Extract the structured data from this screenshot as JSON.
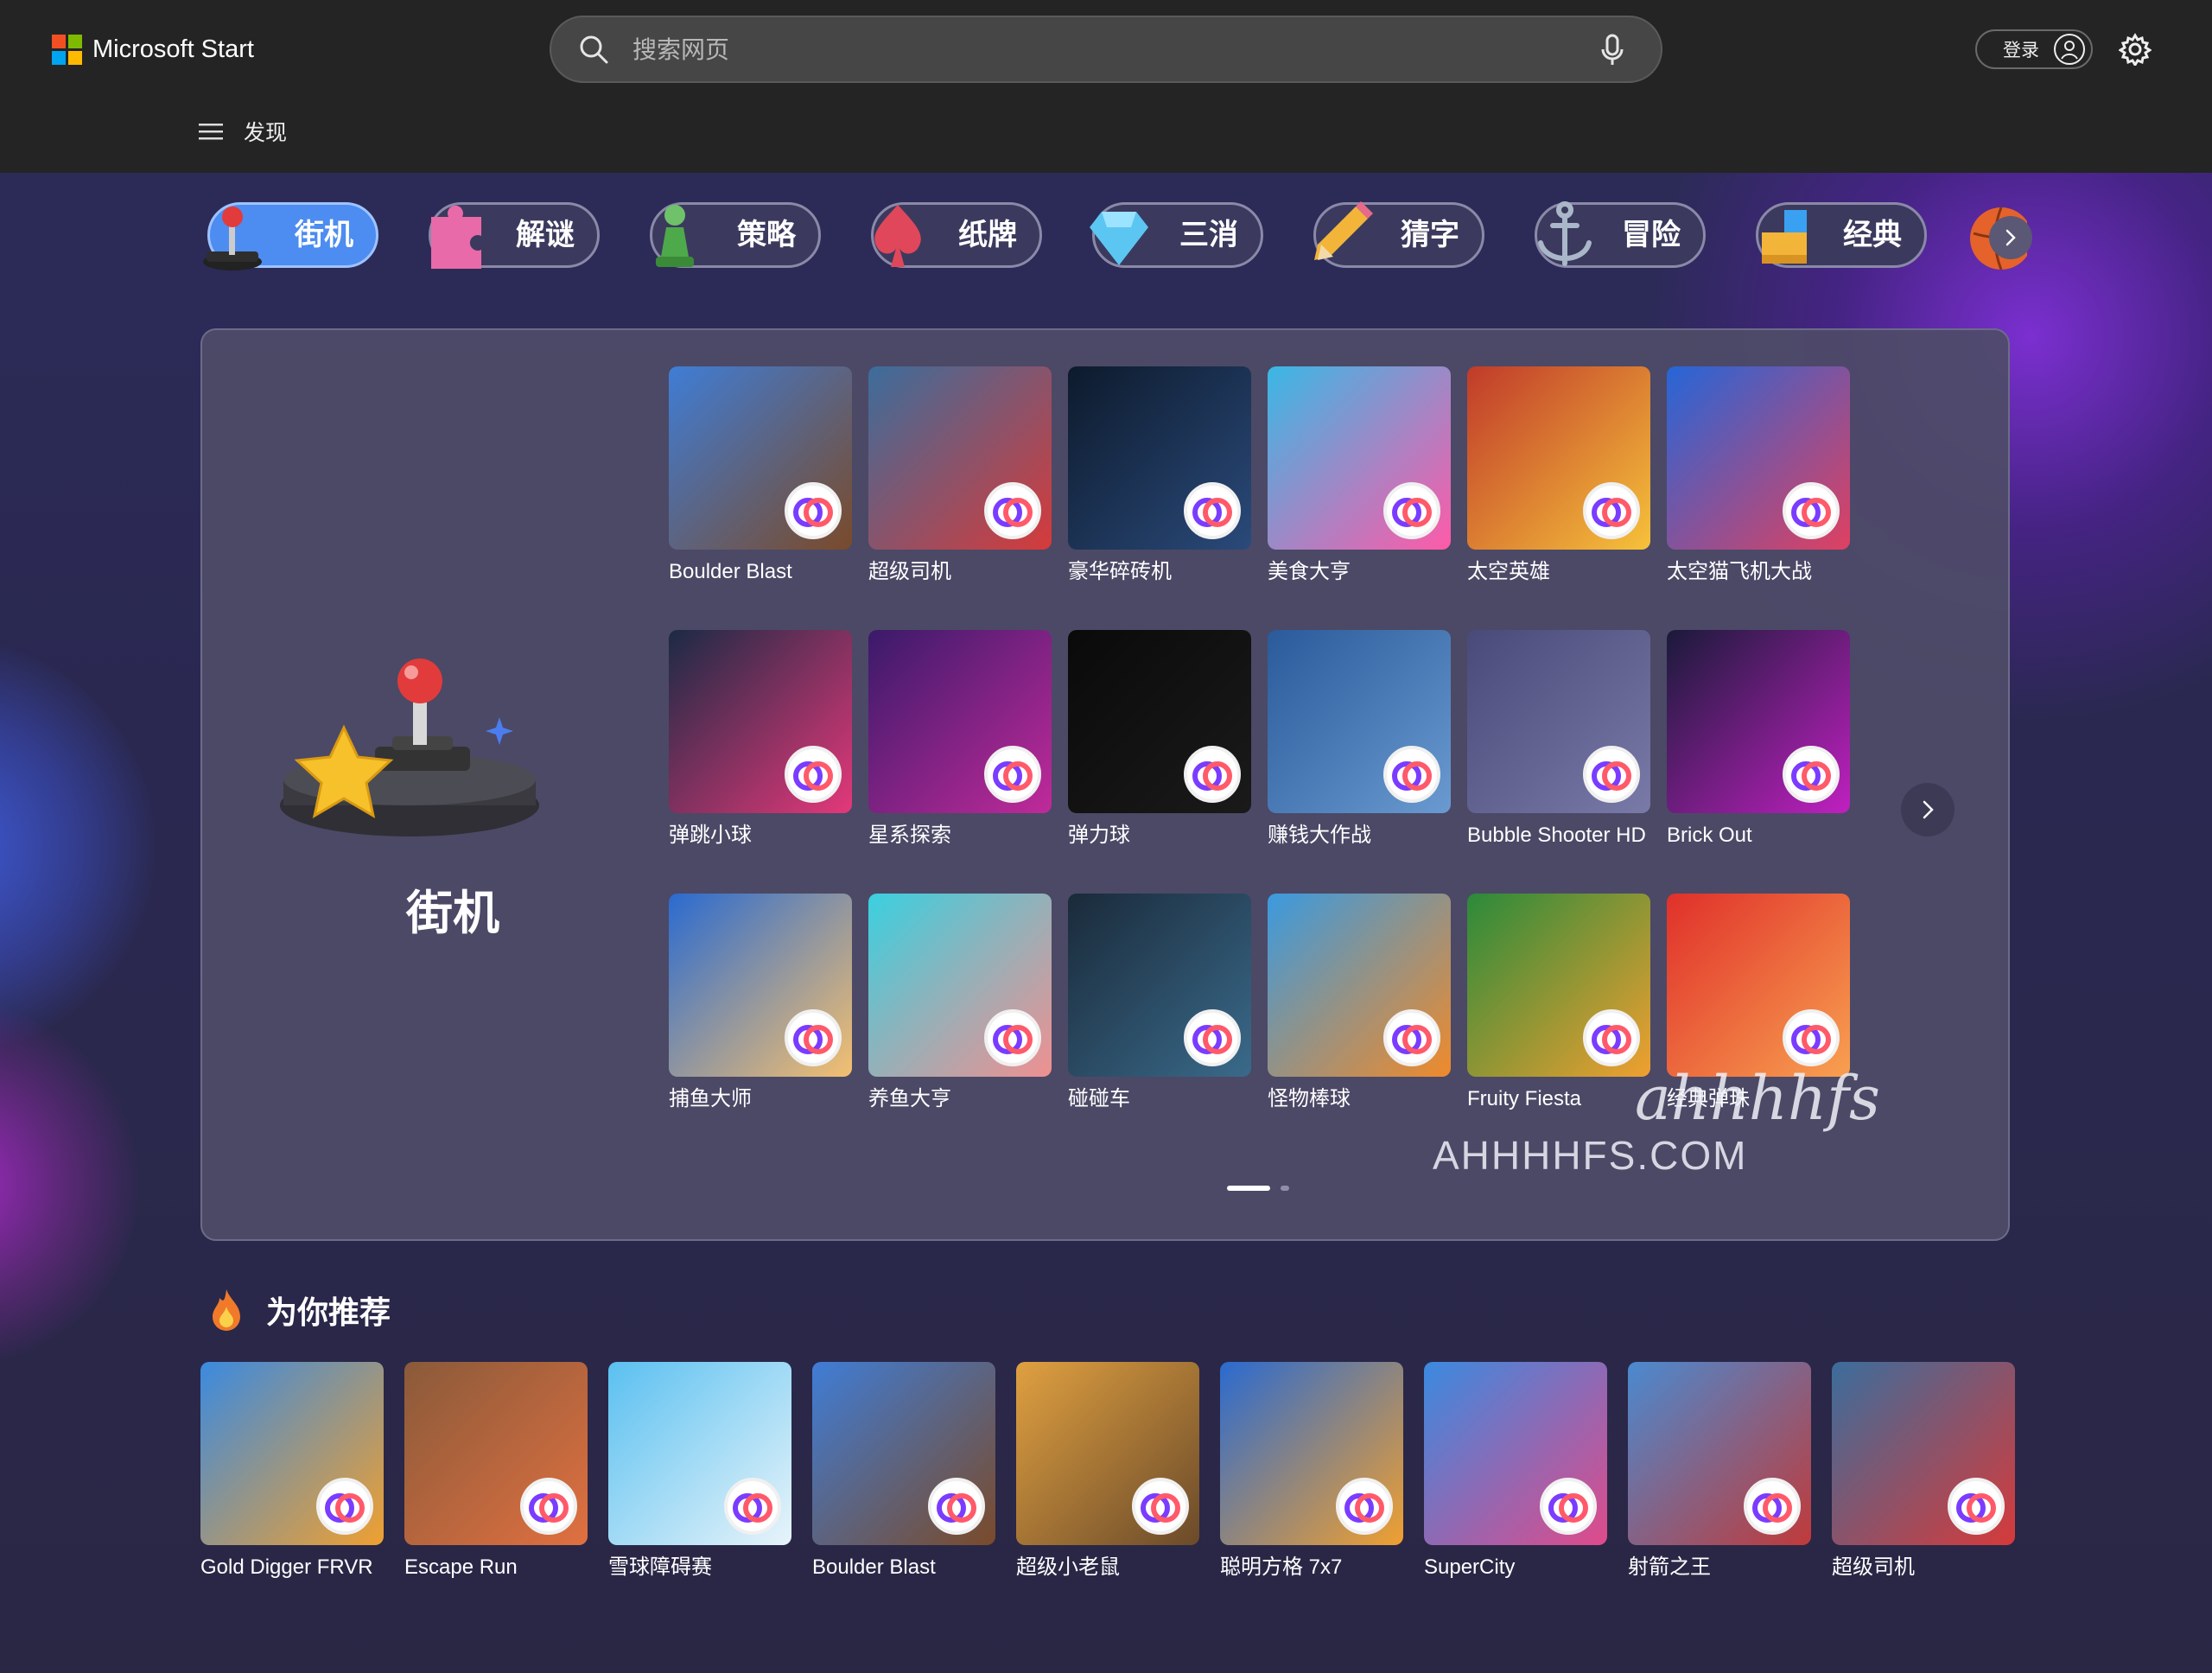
{
  "header": {
    "brand": "Microsoft Start",
    "brand_colors": [
      "#f25022",
      "#7fba00",
      "#00a4ef",
      "#ffb900"
    ],
    "search_placeholder": "搜索网页",
    "signin_label": "登录",
    "menu_label": "发现"
  },
  "categories": [
    {
      "label": "街机",
      "icon": "joystick-icon",
      "active": true
    },
    {
      "label": "解谜",
      "icon": "puzzle-icon",
      "active": false
    },
    {
      "label": "策略",
      "icon": "chess-pawn-icon",
      "active": false
    },
    {
      "label": "纸牌",
      "icon": "spade-icon",
      "active": false
    },
    {
      "label": "三消",
      "icon": "diamond-icon",
      "active": false
    },
    {
      "label": "猜字",
      "icon": "pencil-icon",
      "active": false
    },
    {
      "label": "冒险",
      "icon": "anchor-icon",
      "active": false
    },
    {
      "label": "经典",
      "icon": "blocks-icon",
      "active": false
    }
  ],
  "featured": {
    "title": "街机",
    "games": [
      {
        "title": "Boulder Blast",
        "bg": [
          "#3f7dd6",
          "#7a4a2a"
        ]
      },
      {
        "title": "超级司机",
        "bg": [
          "#3b6d9c",
          "#d63a3a"
        ]
      },
      {
        "title": "豪华碎砖机",
        "bg": [
          "#0d1a2c",
          "#2a4a7a"
        ]
      },
      {
        "title": "美食大亨",
        "bg": [
          "#39b8e6",
          "#ff5aa8"
        ]
      },
      {
        "title": "太空英雄",
        "bg": [
          "#c03a2a",
          "#f6c23a"
        ]
      },
      {
        "title": "太空猫飞机大战",
        "bg": [
          "#2566d8",
          "#e04060"
        ]
      },
      {
        "title": "弹跳小球",
        "bg": [
          "#1b2a44",
          "#e4387a"
        ]
      },
      {
        "title": "星系探索",
        "bg": [
          "#3a1a6a",
          "#c02a9a"
        ]
      },
      {
        "title": "弹力球",
        "bg": [
          "#0a0a0a",
          "#1a1a1a"
        ]
      },
      {
        "title": "赚钱大作战",
        "bg": [
          "#2a5a9a",
          "#6a9ad0"
        ]
      },
      {
        "title": "Bubble Shooter HD",
        "bg": [
          "#4a4a7a",
          "#7a7aa8"
        ]
      },
      {
        "title": "Brick Out",
        "bg": [
          "#1a1a3a",
          "#c020c0"
        ]
      },
      {
        "title": "捕鱼大师",
        "bg": [
          "#2a6ad0",
          "#f4c070"
        ]
      },
      {
        "title": "养鱼大亨",
        "bg": [
          "#3ad0e0",
          "#f09090"
        ]
      },
      {
        "title": "碰碰车",
        "bg": [
          "#1a2a3a",
          "#3a6a8a"
        ]
      },
      {
        "title": "怪物棒球",
        "bg": [
          "#3a9ae0",
          "#f08a2a"
        ]
      },
      {
        "title": "Fruity Fiesta",
        "bg": [
          "#2a8a3a",
          "#f0a030"
        ]
      },
      {
        "title": "经典弹珠",
        "bg": [
          "#e0302a",
          "#f8a050"
        ]
      }
    ]
  },
  "watermark": {
    "logo": "ahhhhfs",
    "url": "AHHHHFS.COM"
  },
  "recommendations": {
    "title": "为你推荐",
    "games": [
      {
        "title": "Gold Digger FRVR",
        "bg": [
          "#3a8ae0",
          "#f0a030"
        ]
      },
      {
        "title": "Escape Run",
        "bg": [
          "#8a5a3a",
          "#e07040"
        ]
      },
      {
        "title": "雪球障碍赛",
        "bg": [
          "#5ac0f0",
          "#e8f4fa"
        ]
      },
      {
        "title": "Boulder Blast",
        "bg": [
          "#3f7dd6",
          "#7a4a2a"
        ]
      },
      {
        "title": "超级小老鼠",
        "bg": [
          "#e0a040",
          "#6a4a2a"
        ]
      },
      {
        "title": "聪明方格 7x7",
        "bg": [
          "#2a6ad0",
          "#f0a030"
        ]
      },
      {
        "title": "SuperCity",
        "bg": [
          "#3a8ae0",
          "#e04a8a"
        ]
      },
      {
        "title": "射箭之王",
        "bg": [
          "#4a8ad0",
          "#c03a3a"
        ]
      },
      {
        "title": "超级司机",
        "bg": [
          "#3b6d9c",
          "#d63a3a"
        ]
      }
    ]
  }
}
